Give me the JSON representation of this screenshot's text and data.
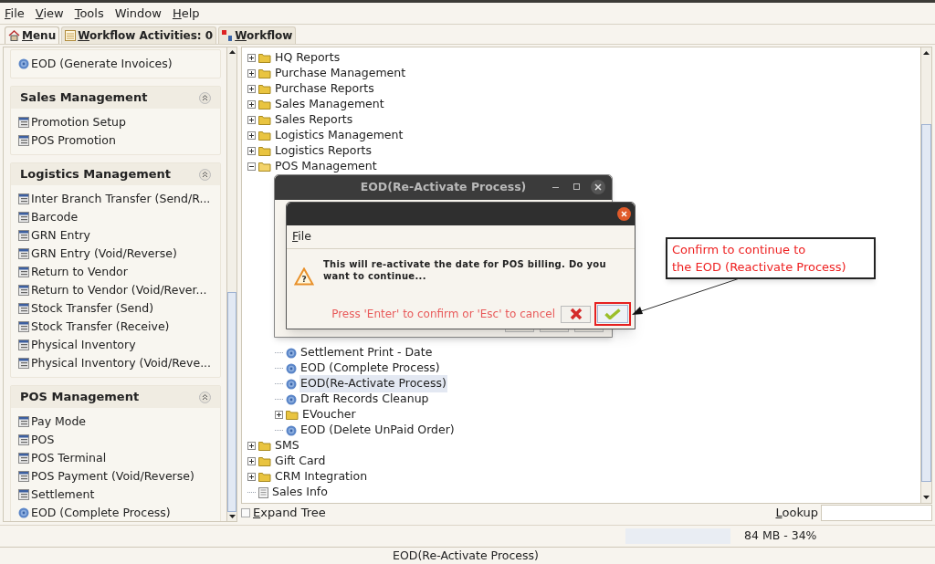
{
  "menu_bar": [
    {
      "label": "File",
      "mnemonic": true
    },
    {
      "label": "View",
      "mnemonic": true
    },
    {
      "label": "Tools",
      "mnemonic": true
    },
    {
      "label": "Window",
      "mnemonic": false
    },
    {
      "label": "Help",
      "mnemonic": true
    }
  ],
  "tabs": [
    {
      "label": "Menu",
      "selected": true
    },
    {
      "label": "Workflow Activities: 0",
      "selected": false
    },
    {
      "label": "Workflow",
      "selected": false
    }
  ],
  "sidebar": {
    "sections": [
      {
        "items": [
          {
            "label": "EOD (Generate Invoices)",
            "kind": "process"
          }
        ]
      },
      {
        "title": "Sales Management",
        "items": [
          {
            "label": "Promotion Setup",
            "kind": "form"
          },
          {
            "label": "POS Promotion",
            "kind": "form"
          }
        ]
      },
      {
        "title": "Logistics Management",
        "items": [
          {
            "label": "Inter Branch Transfer (Send/R...",
            "kind": "form"
          },
          {
            "label": "Barcode",
            "kind": "form"
          },
          {
            "label": "GRN Entry",
            "kind": "form"
          },
          {
            "label": "GRN Entry (Void/Reverse)",
            "kind": "form"
          },
          {
            "label": "Return to Vendor",
            "kind": "form"
          },
          {
            "label": "Return to Vendor (Void/Rever...",
            "kind": "form"
          },
          {
            "label": "Stock Transfer (Send)",
            "kind": "form"
          },
          {
            "label": "Stock Transfer (Receive)",
            "kind": "form"
          },
          {
            "label": "Physical Inventory",
            "kind": "form"
          },
          {
            "label": "Physical Inventory (Void/Reve...",
            "kind": "form"
          }
        ]
      },
      {
        "title": "POS Management",
        "items": [
          {
            "label": "Pay Mode",
            "kind": "form"
          },
          {
            "label": "POS",
            "kind": "form"
          },
          {
            "label": "POS Terminal",
            "kind": "form"
          },
          {
            "label": "POS Payment (Void/Reverse)",
            "kind": "form"
          },
          {
            "label": "Settlement",
            "kind": "form"
          },
          {
            "label": "EOD (Complete Process)",
            "kind": "process"
          }
        ]
      }
    ]
  },
  "tree": [
    {
      "label": "HQ Reports",
      "kind": "folder",
      "expanded": false,
      "selected": false
    },
    {
      "label": "Purchase Management",
      "kind": "folder",
      "expanded": false,
      "selected": false
    },
    {
      "label": "Purchase Reports",
      "kind": "folder",
      "expanded": false,
      "selected": false
    },
    {
      "label": "Sales Management",
      "kind": "folder",
      "expanded": false,
      "selected": false
    },
    {
      "label": "Sales Reports",
      "kind": "folder",
      "expanded": false,
      "selected": false
    },
    {
      "label": "Logistics Management",
      "kind": "folder",
      "expanded": false,
      "selected": false
    },
    {
      "label": "Logistics Reports",
      "kind": "folder",
      "expanded": false,
      "selected": false
    },
    {
      "label": "POS Management",
      "kind": "folder",
      "expanded": true,
      "selected": false,
      "children": [
        {
          "label": "Settlement Print - Date",
          "kind": "process",
          "selected": false
        },
        {
          "label": "EOD (Complete Process)",
          "kind": "process",
          "selected": false
        },
        {
          "label": "EOD(Re-Activate Process)",
          "kind": "process",
          "selected": true
        },
        {
          "label": "Draft Records Cleanup",
          "kind": "process",
          "selected": false
        },
        {
          "label": "EVoucher",
          "kind": "folder",
          "expanded": false,
          "selected": false
        },
        {
          "label": "EOD (Delete UnPaid Order)",
          "kind": "process",
          "selected": false
        }
      ]
    },
    {
      "label": "SMS",
      "kind": "folder",
      "expanded": false,
      "selected": false
    },
    {
      "label": "Gift Card",
      "kind": "folder",
      "expanded": false,
      "selected": false
    },
    {
      "label": "CRM Integration",
      "kind": "folder",
      "expanded": false,
      "selected": false
    },
    {
      "label": "Sales Info",
      "kind": "document",
      "selected": false
    }
  ],
  "expand_tree": {
    "label": "Expand Tree",
    "checked": false
  },
  "lookup": {
    "label": "Lookup"
  },
  "memory": {
    "reading": "84 MB - 34%"
  },
  "status_bar": "EOD(Re-Activate Process)",
  "back_dialog": {
    "title": "EOD(Re-Activate Process)"
  },
  "confirm_dialog": {
    "menu": "File",
    "warning_mark": "?",
    "message": "This will re-activate the date for POS billing. Do you want to continue...",
    "hint": "Press 'Enter' to confirm or 'Esc' to cancel"
  },
  "callout": "Confirm to continue to\nthe EOD (Reactivate Process)"
}
